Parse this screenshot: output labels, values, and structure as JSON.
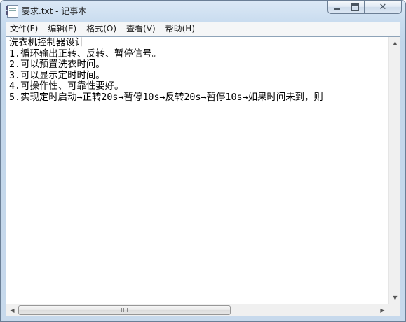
{
  "window": {
    "title": "要求.txt - 记事本",
    "app_icon": "notepad-icon",
    "controls": {
      "minimize_icon": "minimize-icon",
      "maximize_icon": "maximize-icon",
      "close_icon": "close-icon",
      "close_glyph": "✕"
    }
  },
  "menu": {
    "items": [
      {
        "label": "文件(F)"
      },
      {
        "label": "编辑(E)"
      },
      {
        "label": "格式(O)"
      },
      {
        "label": "查看(V)"
      },
      {
        "label": "帮助(H)"
      }
    ]
  },
  "document": {
    "lines": [
      "洗衣机控制器设计",
      "1.循环输出正转、反转、暂停信号。",
      "2.可以预置洗衣时间。",
      "3.可以显示定时时间。",
      "4.可操作性、可靠性要好。",
      "5.实现定时启动→正转20s→暂停10s→反转20s→暂停10s→如果时间未到，则"
    ]
  },
  "scrollbars": {
    "up_arrow": "▲",
    "down_arrow": "▼",
    "left_arrow": "◀",
    "right_arrow": "▶"
  }
}
